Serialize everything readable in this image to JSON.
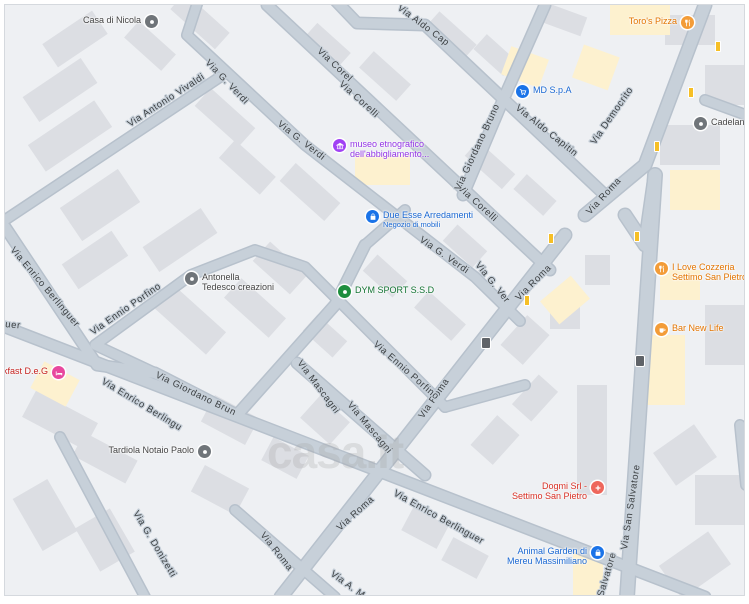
{
  "map": {
    "colors": {
      "background": "#eef0f3",
      "road": "#c7d0d9",
      "road_edge": "#b7c1cc",
      "building": "#dcdee3",
      "highlight_area": "#fdf1cf"
    },
    "streets": [
      {
        "id": "corelli-1",
        "name": "Via Corelli"
      },
      {
        "id": "corelli-2",
        "name": "Via Corelli"
      },
      {
        "id": "corelli-3",
        "name": "Via Corelli"
      },
      {
        "id": "aldo-capitini-1",
        "name": "Via Aldo Capitini"
      },
      {
        "id": "aldo-capitini-2",
        "name": "Via Aldo Capitini"
      },
      {
        "id": "giordano-bruno-1",
        "name": "Via Giordano Bruno"
      },
      {
        "id": "giordano-bruno-2",
        "name": "Via Giordano Bruno"
      },
      {
        "id": "verdi-1",
        "name": "Via G. Verdi"
      },
      {
        "id": "verdi-2",
        "name": "Via G. Verdi"
      },
      {
        "id": "verdi-3",
        "name": "Via G. Verdi"
      },
      {
        "id": "verdi-4",
        "name": "Via G. Verdi"
      },
      {
        "id": "antonio-vivaldi",
        "name": "Via Antonio Vivaldi"
      },
      {
        "id": "democrito",
        "name": "Via Democrito"
      },
      {
        "id": "roma-1",
        "name": "Via Roma"
      },
      {
        "id": "roma-2",
        "name": "Via Roma"
      },
      {
        "id": "roma-3",
        "name": "Via Roma"
      },
      {
        "id": "roma-4",
        "name": "Via Roma"
      },
      {
        "id": "roma-5",
        "name": "Via Roma"
      },
      {
        "id": "ennio-porfino-1",
        "name": "Via Ennio Porfino"
      },
      {
        "id": "ennio-porfino-2",
        "name": "Via Ennio Porfino"
      },
      {
        "id": "enrico-berlinguer-1",
        "name": "Via Enrico Berlinguer"
      },
      {
        "id": "enrico-berlinguer-2",
        "name": "Via Enrico Berlinguer"
      },
      {
        "id": "enrico-berlinguer-3",
        "name": "Via Enrico Berlinguer"
      },
      {
        "id": "mascagni-1",
        "name": "Via Mascagni"
      },
      {
        "id": "mascagni-2",
        "name": "Via Mascagni"
      },
      {
        "id": "donizetti",
        "name": "Via G. Donizetti"
      },
      {
        "id": "a-moro",
        "name": "Via A. M"
      },
      {
        "id": "san-salvatore-1",
        "name": "Via San Salvatore"
      },
      {
        "id": "san-salvatore-2",
        "name": "Salvatore"
      },
      {
        "id": "ber-edge",
        "name": "uer"
      }
    ],
    "pois": [
      {
        "id": "casa-di-nicola",
        "line1": "Casa di Nicola",
        "line2": "",
        "color": "gray",
        "icon": "pin-icon"
      },
      {
        "id": "toros-pizza",
        "line1": "Toro's Pizza",
        "line2": "",
        "color": "orange",
        "icon": "fork-knife-icon"
      },
      {
        "id": "md-spa",
        "line1": "MD S.p.A",
        "line2": "",
        "color": "blue",
        "icon": "cart-icon"
      },
      {
        "id": "cadelanu",
        "line1": "Cadelanu",
        "line2": "",
        "color": "gray",
        "icon": "pin-icon"
      },
      {
        "id": "museo",
        "line1": "museo etnografico",
        "line2": "dell'abbigliamento...",
        "color": "purple",
        "icon": "museum-icon"
      },
      {
        "id": "due-esse",
        "line1": "Due Esse Arredamenti",
        "line2": "Negozio di mobili",
        "color": "blue",
        "icon": "shopping-bag-icon"
      },
      {
        "id": "i-love-cozzeria",
        "line1": "I Love Cozzeria",
        "line2": "Settimo San Pietro",
        "color": "orange",
        "icon": "fork-knife-icon"
      },
      {
        "id": "dym-sport",
        "line1": "DYM SPORT S.S.D",
        "line2": "",
        "color": "green",
        "icon": "pin-icon"
      },
      {
        "id": "antonella",
        "line1": "Antonella",
        "line2": "Tedesco creazioni",
        "color": "gray",
        "icon": "pin-icon"
      },
      {
        "id": "bar-new-life",
        "line1": "Bar New Life",
        "line2": "",
        "color": "orange",
        "icon": "cup-icon"
      },
      {
        "id": "breakfast",
        "line1": "eakfast D.e.G",
        "line2": "",
        "color": "pink",
        "icon": "hotel-icon"
      },
      {
        "id": "tardiola",
        "line1": "Tardiola Notaio Paolo",
        "line2": "",
        "color": "gray",
        "icon": "pin-icon"
      },
      {
        "id": "dogmi",
        "line1": "Dogmi Srl -",
        "line2": "Settimo San Pietro",
        "color": "red",
        "icon": "medical-cross-icon"
      },
      {
        "id": "animal-garden",
        "line1": "Animal Garden di",
        "line2": "Mereu Massimiliano",
        "color": "blue",
        "icon": "shopping-bag-icon"
      }
    ],
    "watermark": "casa.it"
  }
}
